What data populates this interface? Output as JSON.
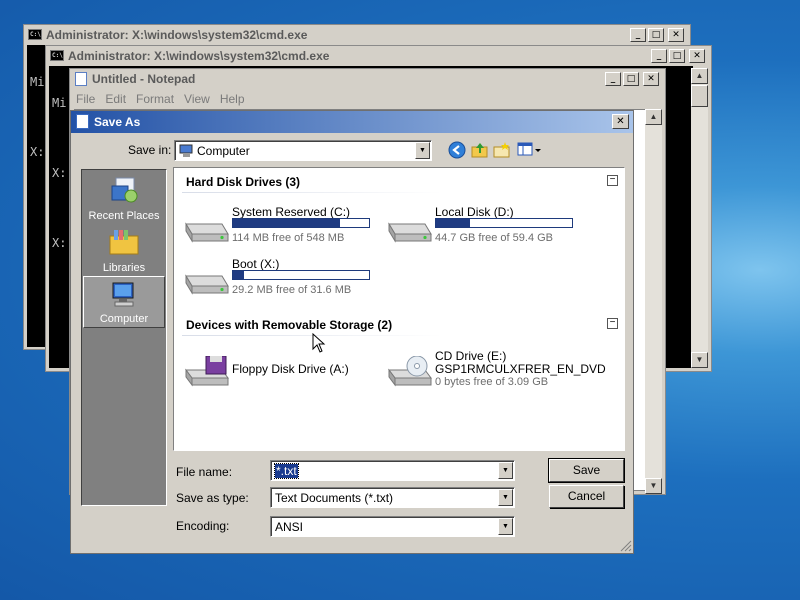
{
  "cmd_back": {
    "title": "Administrator: X:\\windows\\system32\\cmd.exe",
    "lines": [
      "Mi",
      "",
      "X:"
    ]
  },
  "cmd_front": {
    "title": "Administrator: X:\\windows\\system32\\cmd.exe",
    "lines": [
      "Mi",
      "",
      "X:",
      "",
      "X:"
    ]
  },
  "notepad": {
    "title": "Untitled - Notepad",
    "menu": [
      "File",
      "Edit",
      "Format",
      "View",
      "Help"
    ]
  },
  "save_dialog": {
    "title": "Save As",
    "save_in_label": "Save in:",
    "save_in_value": "Computer",
    "places": [
      {
        "label": "Recent Places",
        "icon": "recent-places-icon"
      },
      {
        "label": "Libraries",
        "icon": "libraries-icon"
      },
      {
        "label": "Computer",
        "icon": "computer-icon"
      }
    ],
    "groups": [
      {
        "title": "Hard Disk Drives (3)",
        "drives": [
          {
            "name": "System Reserved (C:)",
            "free": "114 MB free of 548 MB",
            "used": 0.79
          },
          {
            "name": "Local Disk (D:)",
            "free": "44.7 GB free of 59.4 GB",
            "used": 0.25
          },
          {
            "name": "Boot (X:)",
            "free": "29.2 MB free of 31.6 MB",
            "used": 0.08
          }
        ]
      },
      {
        "title": "Devices with Removable Storage (2)",
        "drives": [
          {
            "name": "Floppy Disk Drive (A:)"
          },
          {
            "name": "CD Drive (E:)",
            "sub": "GSP1RMCULXFRER_EN_DVD",
            "free": "0 bytes free of 3.09 GB"
          }
        ]
      }
    ],
    "collapse_glyph": "−",
    "file_name_label": "File name:",
    "file_name_value": "*.txt",
    "save_as_type_label": "Save as type:",
    "save_as_type_value": "Text Documents (*.txt)",
    "encoding_label": "Encoding:",
    "encoding_value": "ANSI",
    "save_button": "Save",
    "cancel_button": "Cancel"
  },
  "colors": {
    "desktop": "#1d6fbe",
    "title_active": "#2352a6",
    "usage_bar": "#1f3b82"
  }
}
